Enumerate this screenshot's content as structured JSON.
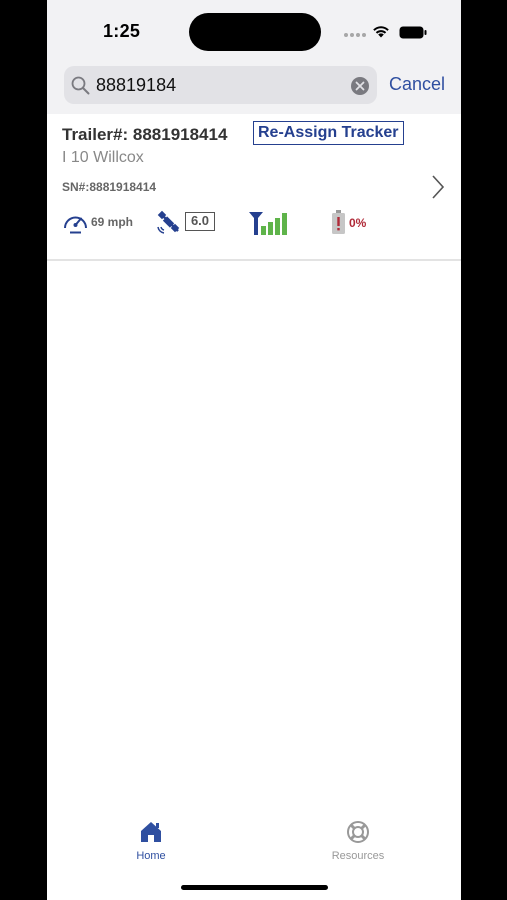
{
  "status_bar": {
    "time": "1:25"
  },
  "search": {
    "value": "88819184",
    "cancel_label": "Cancel"
  },
  "result": {
    "trailer_label": "Trailer#: 8881918414",
    "reassign_label": "Re-Assign Tracker",
    "location": "I 10 Willcox",
    "serial": "SN#:8881918414",
    "speed": "69 mph",
    "gps_value": "6.0",
    "battery_percent": "0%"
  },
  "tabs": [
    {
      "label": "Home",
      "icon": "home-icon",
      "active": true
    },
    {
      "label": "Resources",
      "icon": "lifebuoy-icon",
      "active": false
    }
  ],
  "colors": {
    "accent": "#2f4fa0",
    "tracker_blue": "#25408f",
    "signal_green": "#5fb44a",
    "alert_red": "#b02a38"
  }
}
